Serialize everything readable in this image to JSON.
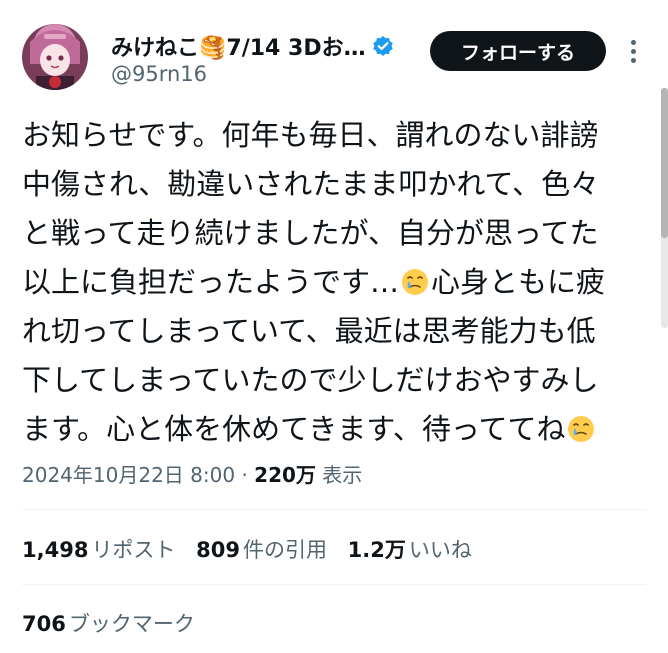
{
  "author": {
    "display_name": "みけねこ🥞7/14 3Dお…",
    "handle": "@95rn16",
    "verified_icon": "verified-badge-icon",
    "avatar_icon": "profile-avatar"
  },
  "header": {
    "follow_label": "フォローする",
    "more_icon": "more-options-icon"
  },
  "tweet": {
    "lines": [
      "お知らせです。何年も毎日、謂れのない誹謗",
      "中傷され、勘違いされたまま叩かれて、色々",
      "と戦って走り続けましたが、自分が思ってた",
      "以上に負担だったようです…",
      "心身ともに疲",
      "れ切ってしまっていて、最近は思考能力も低",
      "下してしまっていたので少しだけおやすみし",
      "ます。心と体を休めてきます、待っててね"
    ],
    "emoji": "holding-back-tears-emoji"
  },
  "meta": {
    "datetime": "2024年10月22日 8:00",
    "separator": "·",
    "views_count": "220万",
    "views_label": "表示"
  },
  "stats": {
    "reposts_count": "1,498",
    "reposts_label": "リポスト",
    "quotes_count": "809",
    "quotes_label": "件の引用",
    "likes_count": "1.2万",
    "likes_label": "いいね"
  },
  "bookmarks": {
    "count": "706",
    "label": "ブックマーク"
  },
  "colors": {
    "text": "#0f1419",
    "secondary": "#536471",
    "verified": "#1d9bf0",
    "divider": "#eff3f4"
  }
}
